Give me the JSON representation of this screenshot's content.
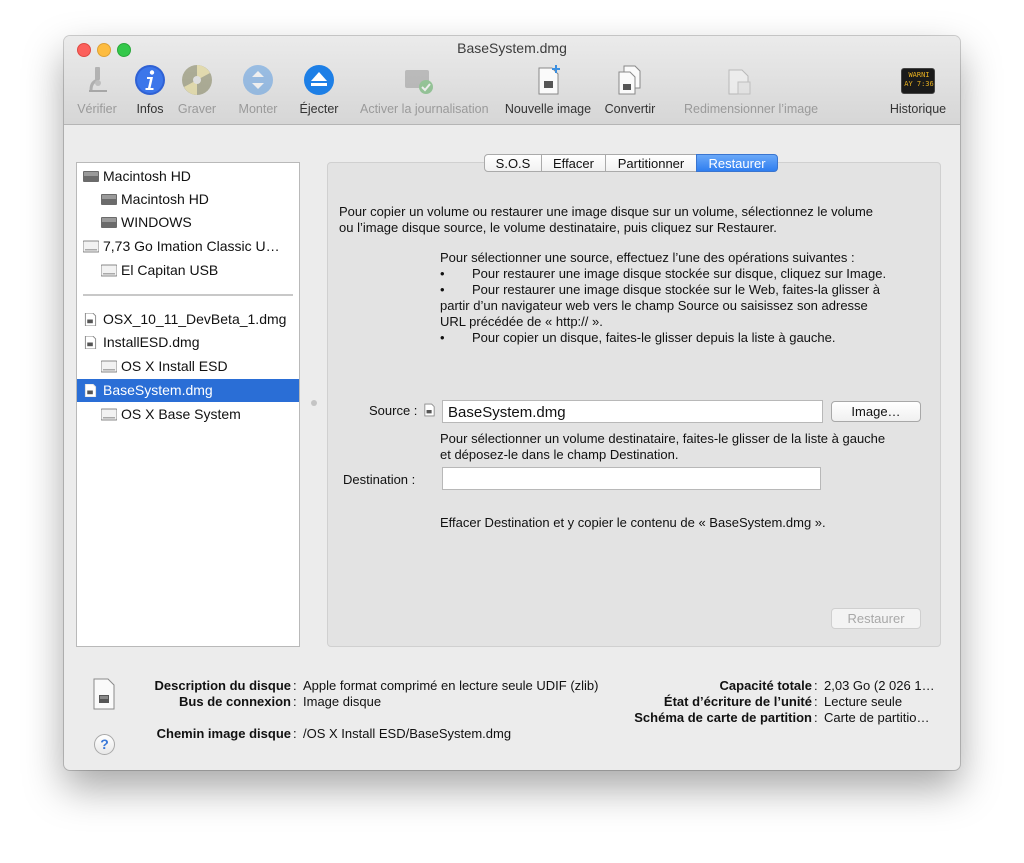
{
  "window": {
    "title": "BaseSystem.dmg"
  },
  "toolbar": [
    {
      "label": "Vérifier",
      "icon": "microscope-icon",
      "enabled": false
    },
    {
      "label": "Infos",
      "icon": "info-icon",
      "enabled": true
    },
    {
      "label": "Graver",
      "icon": "burn-icon",
      "enabled": false
    },
    {
      "label": "Monter",
      "icon": "mount-icon",
      "enabled": false
    },
    {
      "label": "Éjecter",
      "icon": "eject-icon",
      "enabled": true
    },
    {
      "label": "Activer la journalisation",
      "icon": "journaling-icon",
      "enabled": false
    },
    {
      "label": "Nouvelle image",
      "icon": "new-image-icon",
      "enabled": true
    },
    {
      "label": "Convertir",
      "icon": "convert-icon",
      "enabled": true
    },
    {
      "label": "Redimensionner l’image",
      "icon": "resize-image-icon",
      "enabled": false
    },
    {
      "label": "Historique",
      "icon": "log-icon",
      "enabled": true,
      "badge_lines": [
        "WARNI",
        "AY 7:36"
      ]
    }
  ],
  "sidebar": {
    "items": [
      {
        "label": "Macintosh HD",
        "icon": "internal-disk-icon",
        "indent": 0
      },
      {
        "label": "Macintosh HD",
        "icon": "internal-disk-icon",
        "indent": 1
      },
      {
        "label": "WINDOWS",
        "icon": "internal-disk-icon",
        "indent": 1
      },
      {
        "label": "7,73 Go Imation Classic U…",
        "icon": "external-disk-icon",
        "indent": 0
      },
      {
        "label": "El Capitan USB",
        "icon": "external-disk-icon",
        "indent": 1
      },
      {
        "label": "OSX_10_11_DevBeta_1.dmg",
        "icon": "dmg-file-icon",
        "indent": 0
      },
      {
        "label": "InstallESD.dmg",
        "icon": "dmg-file-icon",
        "indent": 0
      },
      {
        "label": "OS X Install ESD",
        "icon": "external-disk-icon",
        "indent": 1
      },
      {
        "label": "BaseSystem.dmg",
        "icon": "dmg-file-icon",
        "indent": 0,
        "selected": true
      },
      {
        "label": "OS X Base System",
        "icon": "external-disk-icon",
        "indent": 1
      }
    ]
  },
  "tabs": [
    {
      "label": "S.O.S",
      "active": false
    },
    {
      "label": "Effacer",
      "active": false
    },
    {
      "label": "Partitionner",
      "active": false
    },
    {
      "label": "Restaurer",
      "active": true
    }
  ],
  "restore": {
    "intro_line1": "Pour copier un volume ou restaurer une image disque sur un volume, sélectionnez le volume",
    "intro_line2": "ou l’image disque source, le volume destinataire, puis cliquez sur Restaurer.",
    "source_intro": "Pour sélectionner une source, effectuez l’une des opérations suivantes :",
    "bullet1": "Pour restaurer une image disque stockée sur disque, cliquez sur Image.",
    "bullet2_line1": "Pour restaurer une image disque stockée sur le Web, faites-la glisser à",
    "bullet2_line2": "partir d’un navigateur web vers le champ Source ou saisissez son adresse",
    "bullet2_line3": "URL précédée de « http:// ».",
    "bullet3": "Pour copier un disque, faites-le glisser depuis la liste à gauche.",
    "bullet_mark": "•",
    "source_label": "Source :",
    "source_value": "BaseSystem.dmg",
    "image_button": "Image…",
    "dest_hint_line1": "Pour sélectionner un volume destinataire, faites-le glisser de la liste à gauche",
    "dest_hint_line2": "et déposez-le dans le champ Destination.",
    "destination_label": "Destination :",
    "destination_value": "",
    "summary": "Effacer Destination et y copier le contenu de « BaseSystem.dmg ».",
    "restore_button": "Restaurer"
  },
  "info": {
    "description_label": "Description du disque",
    "description_value": "Apple format comprimé en lecture seule UDIF (zlib)",
    "bus_label": "Bus de connexion",
    "bus_value": "Image disque",
    "path_label": "Chemin image disque",
    "path_value": "/OS X Install ESD/BaseSystem.dmg",
    "capacity_label": "Capacité totale",
    "capacity_value": "2,03 Go (2 026 1…",
    "write_label": "État d’écriture de l’unité",
    "write_value": "Lecture seule",
    "scheme_label": "Schéma de carte de partition",
    "scheme_value": "Carte de partitio…",
    "separator": ":",
    "help": "?"
  }
}
